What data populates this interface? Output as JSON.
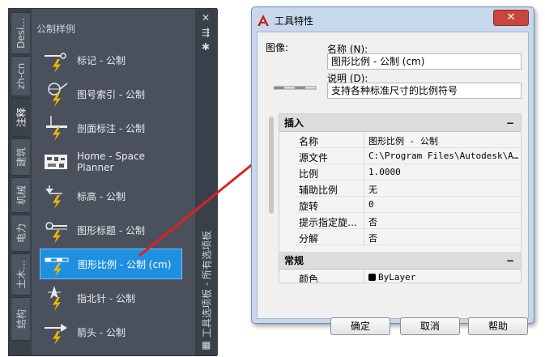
{
  "palette": {
    "title": "公制样例",
    "tabs": [
      {
        "label": "Desi..."
      },
      {
        "label": "zh-cn"
      },
      {
        "label": "注释",
        "active": true
      },
      {
        "label": "建筑"
      },
      {
        "label": "机械"
      },
      {
        "label": "电力"
      },
      {
        "label": "土木..."
      },
      {
        "label": "结构"
      }
    ],
    "tools": [
      {
        "label": "标记 - 公制",
        "icon": "tag-icon"
      },
      {
        "label": "图号索引 - 公制",
        "icon": "callout-icon"
      },
      {
        "label": "剖面标注 - 公制",
        "icon": "section-mark-icon"
      },
      {
        "label": "Home - Space Planner",
        "icon": "space-planner-icon"
      },
      {
        "label": "标高 - 公制",
        "icon": "elevation-icon"
      },
      {
        "label": "图形标题 - 公制",
        "icon": "drawing-title-icon"
      },
      {
        "label": "图形比例 - 公制 (cm)",
        "icon": "scale-bar-icon",
        "selected": true
      },
      {
        "label": "指北针 - 公制",
        "icon": "north-arrow-icon"
      },
      {
        "label": "箭头 - 公制",
        "icon": "arrow-icon"
      }
    ],
    "side_title": "工具选项板 - 所有选项板",
    "controls": {
      "close": "✕",
      "autohide": "⇶",
      "properties": "✱"
    }
  },
  "dialog": {
    "title": "工具特性",
    "close_label": "✕",
    "image_label": "图像:",
    "name_label": "名称 (N):",
    "name_value": "图形比例 - 公制 (cm)",
    "desc_label": "说明 (D):",
    "desc_value": "支持各种标准尺寸的比例符号",
    "sections": {
      "insert": {
        "title": "插入",
        "toggle": "−",
        "rows": [
          {
            "name": "名称",
            "value": "图形比例 - 公制"
          },
          {
            "name": "源文件",
            "value": "C:\\Program  Files\\Autodesk\\A…"
          },
          {
            "name": "比例",
            "value": "1.0000"
          },
          {
            "name": "辅助比例",
            "value": "无"
          },
          {
            "name": "旋转",
            "value": "0"
          },
          {
            "name": "提示指定旋…",
            "value": "否"
          },
          {
            "name": "分解",
            "value": "否"
          }
        ]
      },
      "general": {
        "title": "常规",
        "toggle": "−",
        "rows": [
          {
            "name": "颜色",
            "value": "ByLayer"
          }
        ]
      }
    },
    "buttons": {
      "ok": "确定",
      "cancel": "取消",
      "help": "帮助"
    }
  },
  "colors": {
    "arrow": "#e02020",
    "selected": "#1f8fe0",
    "lightning": "#f5b800"
  }
}
